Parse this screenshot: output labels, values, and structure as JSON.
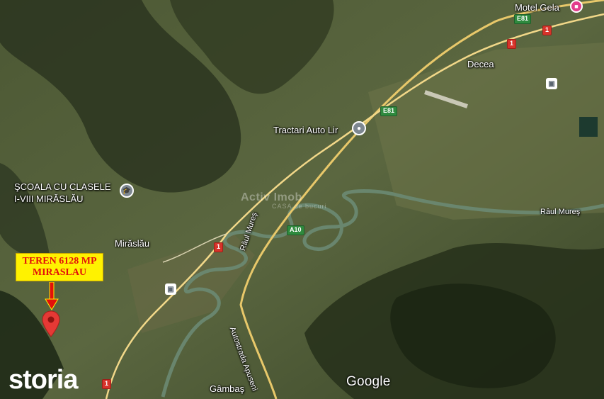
{
  "map": {
    "places": {
      "motel": "Motel Gela",
      "decea": "Decea",
      "tractari": "Tractari Auto Lir",
      "school_line1": "ŞCOALA CU CLASELE",
      "school_line2": "I-VIII MIRĂSLĂU",
      "miraslau": "Mirăslău",
      "gambas": "Gâmbaş",
      "raul_mures_right": "Râul Mureş",
      "raul_mures_mid": "Râul Mureş",
      "autostrada": "Autostrada Apuseni"
    },
    "shields": {
      "e81_top": "E81",
      "e81_mid": "E81",
      "r1_top_right": "1",
      "r1_top": "1",
      "r1_mid": "1",
      "r1_bottom": "1",
      "a10": "A10"
    },
    "callout": {
      "line1": "TEREN 6128 MP",
      "line2": "MIRASLAU"
    },
    "watermark": {
      "line1": "Activ Imob",
      "line2": "CASA de bucuri"
    },
    "google_logo": "Google",
    "brand_logo": "storia",
    "icons": {
      "poi": "location-pin-icon",
      "school": "school-icon",
      "rail": "train-station-icon",
      "hotel": "hotel-icon",
      "pin": "red-map-pin-icon",
      "arrow": "red-down-arrow-icon"
    },
    "colors": {
      "callout_bg": "#fff200",
      "callout_text": "#e2100a",
      "pin": "#e53935",
      "road": "#e8c86a"
    }
  }
}
